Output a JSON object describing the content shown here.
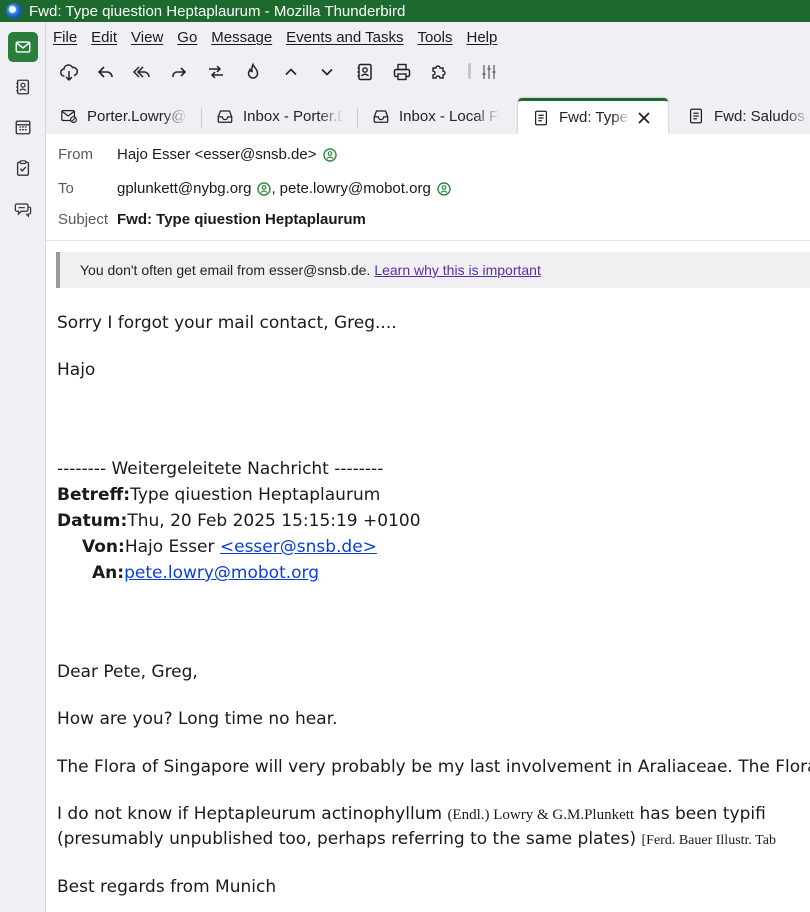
{
  "window": {
    "title": "Fwd: Type qiuestion Heptaplaurum - Mozilla Thunderbird"
  },
  "spaces": [
    {
      "name": "mail-space",
      "icon": "mail-icon",
      "active": true
    },
    {
      "name": "address-book-space",
      "icon": "address-book-icon"
    },
    {
      "name": "calendar-space",
      "icon": "calendar-icon"
    },
    {
      "name": "tasks-space",
      "icon": "tasks-icon"
    },
    {
      "name": "chat-space",
      "icon": "chat-icon"
    }
  ],
  "menu": [
    "File",
    "Edit",
    "View",
    "Go",
    "Message",
    "Events and Tasks",
    "Tools",
    "Help"
  ],
  "toolbar": {
    "buttons": [
      "get-messages-icon",
      "reply-icon",
      "reply-all-icon",
      "forward-icon",
      "redirect-icon",
      "junk-icon",
      "previous-icon",
      "next-icon",
      "address-book-icon",
      "print-icon",
      "addons-icon",
      "customize-icon"
    ]
  },
  "tabs": [
    {
      "label": "Porter.Lowry@mobot.org",
      "icon": "mail-account-icon"
    },
    {
      "label": "Inbox - Porter.Lowry@mobot.org",
      "icon": "inbox-icon"
    },
    {
      "label": "Inbox - Local Folders",
      "icon": "inbox-icon"
    },
    {
      "label": "Fwd: Type qiuestion Heptaplaurum",
      "icon": "message-icon",
      "active": true
    },
    {
      "label": "Fwd: Saludos Dr. Lowry",
      "icon": "message-icon"
    }
  ],
  "header": {
    "from_label": "From",
    "from_value": "Hajo Esser <esser@snsb.de>",
    "to_label": "To",
    "to_values": [
      "gplunkett@nybg.org",
      "pete.lowry@mobot.org"
    ],
    "to_separator": ",",
    "subject_label": "Subject",
    "subject_value": "Fwd: Type qiuestion Heptaplaurum"
  },
  "notice": {
    "text": "You don't often get email from esser@snsb.de.",
    "link": "Learn why this is important"
  },
  "body": {
    "line1": "Sorry I forgot your mail contact, Greg....",
    "line2": "Hajo",
    "fwd_header": "-------- Weitergeleitete Nachricht --------",
    "betreff_label": "Betreff:",
    "betreff_value": "Type qiuestion Heptaplaurum",
    "datum_label": "Datum:",
    "datum_value": "Thu, 20 Feb 2025 15:15:19 +0100",
    "von_label": "Von:",
    "von_name": "Hajo Esser ",
    "von_email": "<esser@snsb.de>",
    "an_label": "An:",
    "an_email": "pete.lowry@mobot.org",
    "greeting": "Dear Pete, Greg,",
    "p1": "How are you? Long time no hear.",
    "p2": "The Flora of Singapore will very probably be my last involvement in Araliaceae. The Flora",
    "p3_a": "I do not know if Heptapleurum actinophyllum ",
    "p3_b": "(Endl.) Lowry & G.M.Plunkett",
    "p3_c": " has been typifi",
    "p4_a": "(presumably unpublished too, perhaps referring to the same plates) ",
    "p4_b": "[Ferd. Bauer Illustr. Tab",
    "closing": "Best regards from Munich"
  },
  "colors": {
    "titlebar": "#1c6a2e",
    "accent": "#2a7d3a",
    "link": "#0b3fd8",
    "notice_link": "#5a2ea5",
    "contact_icon": "#2e8b3e"
  }
}
